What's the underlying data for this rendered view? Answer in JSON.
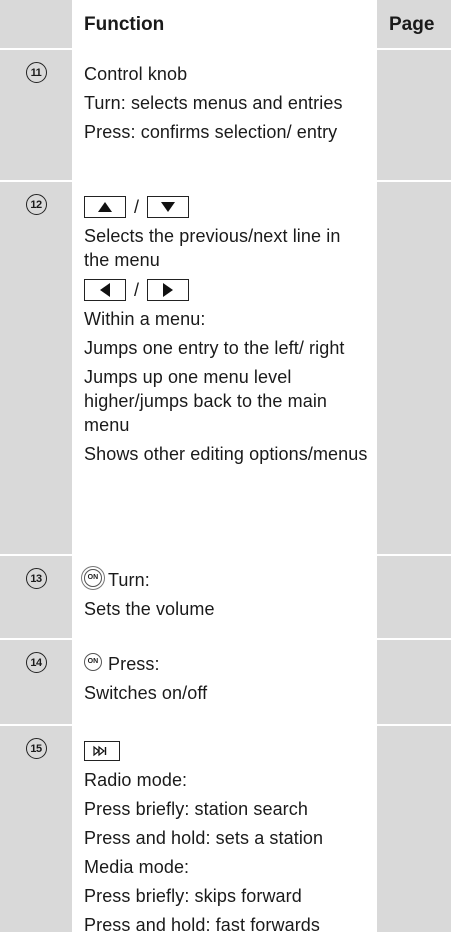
{
  "header": {
    "function_label": "Function",
    "page_label": "Page"
  },
  "rows": [
    {
      "number": "11",
      "lines": [
        "Control knob",
        "Turn: selects menus and entries",
        "Press: confirms selection/ entry"
      ]
    },
    {
      "number": "12",
      "key_separator": "/",
      "lines": [
        "Selects the previous/next line in the menu",
        "Within a menu:",
        "Jumps one entry to the left/ right",
        "Jumps up one menu level higher/jumps back to the main menu",
        "Shows other editing options/menus"
      ],
      "keys_top": [
        "up-arrow-key-icon",
        "down-arrow-key-icon"
      ],
      "keys_mid": [
        "left-arrow-key-icon",
        "right-arrow-key-icon"
      ]
    },
    {
      "number": "13",
      "icon_text": "ON",
      "lines": [
        "Turn:",
        "Sets the volume"
      ]
    },
    {
      "number": "14",
      "icon_text": "ON",
      "lines": [
        "Press:",
        "Switches on/off"
      ]
    },
    {
      "number": "15",
      "key_icon": "skip-forward-key-icon",
      "lines": [
        "Radio mode:",
        "Press briefly: station search",
        "Press and hold: sets a station",
        "Media mode:",
        "Press briefly: skips forward",
        "Press and hold: fast forwards"
      ]
    }
  ]
}
